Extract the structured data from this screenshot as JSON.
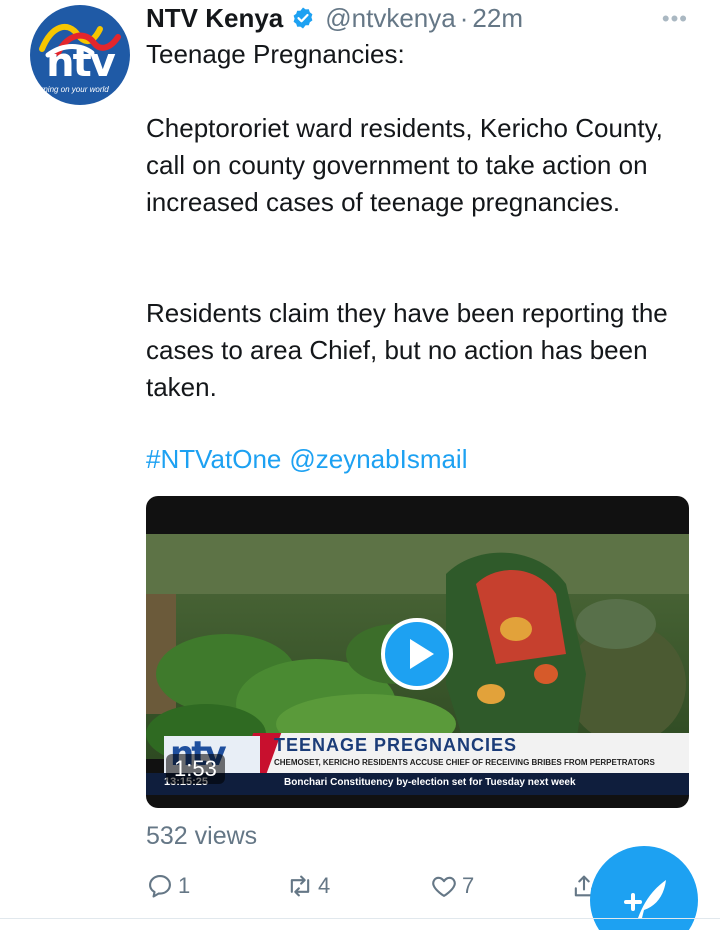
{
  "tweet": {
    "avatar": {
      "logo_text": "ntv",
      "tagline": "turning on your world"
    },
    "display_name": "NTV Kenya",
    "handle": "@ntvkenya",
    "separator": "·",
    "time": "22m",
    "more_label": "•••",
    "text_title": "Teenage Pregnancies:",
    "text_para1": "Cheptororiet ward residents, Kericho County, call on county government to take action on increased cases of teenage pregnancies.",
    "text_para2": "Residents claim they have been reporting the cases to area Chief, but no action has been taken.",
    "hashtag": "#NTVatOne",
    "mention": "@zeynabIsmail"
  },
  "video": {
    "duration": "1:53",
    "overlay_logo": "ntv",
    "headline": "TEENAGE PREGNANCIES",
    "subheadline": "CHEMOSET, KERICHO RESIDENTS ACCUSE CHIEF OF RECEIVING BRIBES FROM PERPETRATORS",
    "clock": "13:15:25",
    "ticker": "Bonchari Constituency by-election set for Tuesday next week"
  },
  "stats": {
    "views": "532 views"
  },
  "actions": {
    "replies": "1",
    "retweets": "4",
    "likes": "7"
  },
  "icons": {
    "verified": "verified-badge-icon",
    "reply": "reply-icon",
    "retweet": "retweet-icon",
    "like": "heart-icon",
    "share": "share-icon",
    "compose": "compose-tweet-icon",
    "play": "play-icon"
  },
  "colors": {
    "accent": "#1da1f2",
    "text": "#14171a",
    "secondary": "#657786",
    "brand_blue": "#1f5aa6",
    "brand_red": "#c8102e"
  }
}
